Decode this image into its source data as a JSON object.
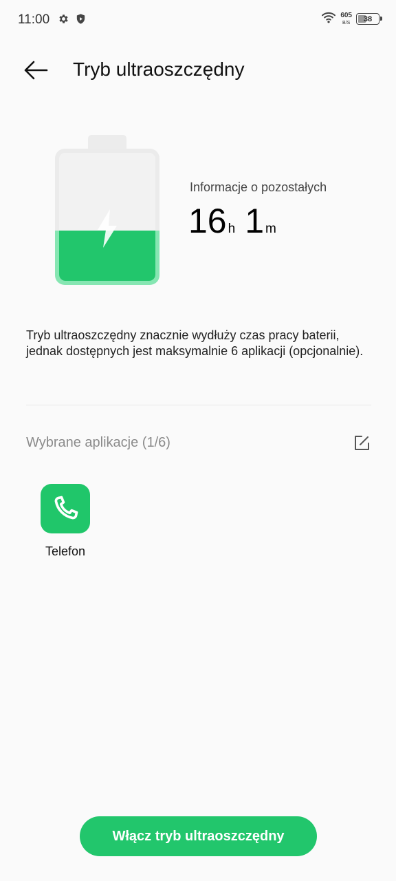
{
  "status_bar": {
    "time": "11:00",
    "left_icons": [
      "settings-gear-icon",
      "shield-play-icon"
    ],
    "wifi_icon": "wifi-icon",
    "net_speed_value": "605",
    "net_speed_unit": "B/S",
    "battery_level": "38"
  },
  "header": {
    "back_icon": "arrow-left-icon",
    "title": "Tryb ultraoszczędny"
  },
  "battery_illustration": {
    "fill_fraction": 0.4,
    "color": "#22c66c",
    "bolt_icon": "lightning-bolt-icon"
  },
  "remaining": {
    "label": "Informacje o pozostałych",
    "hours": "16",
    "hours_unit": "h",
    "minutes": "1",
    "minutes_unit": "m"
  },
  "description": "Tryb ultraoszczędny znacznie wydłuży czas pracy baterii, jednak dostępnych jest maksymalnie 6 aplikacji (opcjonalnie).",
  "apps_section": {
    "title": "Wybrane aplikacje (1/6)",
    "edit_icon": "edit-icon",
    "apps": [
      {
        "label": "Telefon",
        "icon": "phone-icon",
        "color": "#20c66a"
      }
    ]
  },
  "primary_button": {
    "label": "Włącz tryb ultraoszczędny",
    "color": "#22c66c"
  }
}
